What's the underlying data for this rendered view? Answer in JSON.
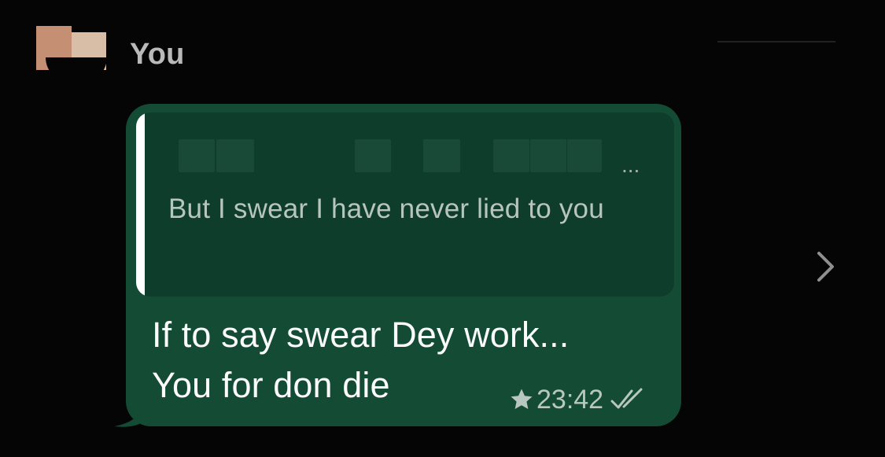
{
  "message": {
    "sender": "You",
    "quoted_sender_suffix": "...",
    "quoted_text": "But I swear I have never lied to you",
    "text": "If to say swear Dey work...\nYou for don die",
    "starred": true,
    "time": "23:42",
    "status": "read"
  },
  "icons": {
    "star": "star-icon",
    "status": "double-check-icon",
    "navigation": "chevron-right-icon"
  },
  "colors": {
    "background": "#050505",
    "bubble": "#134b35",
    "quote_background": "#0f3d2b",
    "quote_accent": "#ffffff",
    "secondary_text": "#b8c7bf"
  }
}
